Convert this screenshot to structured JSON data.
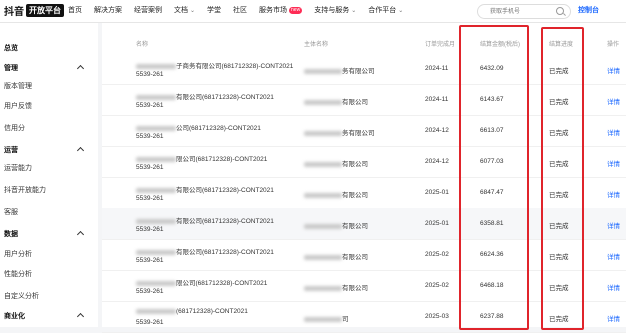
{
  "brand": {
    "name": "抖音",
    "badge": "开放平台"
  },
  "nav": [
    {
      "label": "首页",
      "dropdown": false
    },
    {
      "label": "解决方案",
      "dropdown": false
    },
    {
      "label": "经营案例",
      "dropdown": false
    },
    {
      "label": "文档",
      "dropdown": true
    },
    {
      "label": "学堂",
      "dropdown": false
    },
    {
      "label": "社区",
      "dropdown": false
    },
    {
      "label": "服务市场",
      "dropdown": false,
      "tag": "new"
    },
    {
      "label": "支持与服务",
      "dropdown": true
    },
    {
      "label": "合作平台",
      "dropdown": true
    }
  ],
  "search": {
    "placeholder": "获取手机号"
  },
  "console_label": "控制台",
  "sidebar": [
    {
      "label": "总览",
      "type": "home"
    },
    {
      "label": "管理",
      "type": "group"
    },
    {
      "label": "版本管理",
      "type": "item"
    },
    {
      "label": "用户反馈",
      "type": "item"
    },
    {
      "label": "信用分",
      "type": "item"
    },
    {
      "label": "运营",
      "type": "group"
    },
    {
      "label": "运营能力",
      "type": "item"
    },
    {
      "label": "抖音开放能力",
      "type": "item"
    },
    {
      "label": "客服",
      "type": "item"
    },
    {
      "label": "数据",
      "type": "group"
    },
    {
      "label": "用户分析",
      "type": "item"
    },
    {
      "label": "性能分析",
      "type": "item"
    },
    {
      "label": "自定义分析",
      "type": "item"
    },
    {
      "label": "商业化",
      "type": "group"
    }
  ],
  "table": {
    "headers": [
      "名称",
      "主体名称",
      "订单完成月",
      "结算金额(税后)",
      "结算进度",
      "操作"
    ],
    "rows": [
      {
        "name_visible": "子商务有限公司(681712328)-CONT2021",
        "name_line2": "5539-261",
        "subject_visible": "务有限公司",
        "month": "2024-11",
        "amount": "6432.09",
        "status": "已完成",
        "action": "详情"
      },
      {
        "name_visible": "有限公司(681712328)-CONT2021",
        "name_line2": "5539-261",
        "subject_visible": "有限公司",
        "month": "2024-11",
        "amount": "6143.67",
        "status": "已完成",
        "action": "详情"
      },
      {
        "name_visible": "公司(681712328)-CONT2021",
        "name_line2": "5539-261",
        "subject_visible": "务有限公司",
        "month": "2024-12",
        "amount": "6613.07",
        "status": "已完成",
        "action": "详情"
      },
      {
        "name_visible": "限公司(681712328)-CONT2021",
        "name_line2": "5539-261",
        "subject_visible": "有限公司",
        "month": "2024-12",
        "amount": "6077.03",
        "status": "已完成",
        "action": "详情"
      },
      {
        "name_visible": "有限公司(681712328)-CONT2021",
        "name_line2": "5539-261",
        "subject_visible": "有限公司",
        "month": "2025-01",
        "amount": "6847.47",
        "status": "已完成",
        "action": "详情"
      },
      {
        "name_visible": "有限公司(681712328)-CONT2021",
        "name_line2": "5539-261",
        "subject_visible": "有限公司",
        "month": "2025-01",
        "amount": "6358.81",
        "status": "已完成",
        "action": "详情"
      },
      {
        "name_visible": "有限公司(681712328)-CONT2021",
        "name_line2": "5539-261",
        "subject_visible": "有限公司",
        "month": "2025-02",
        "amount": "6624.36",
        "status": "已完成",
        "action": "详情"
      },
      {
        "name_visible": "限公司(681712328)-CONT2021",
        "name_line2": "5539-261",
        "subject_visible": "有限公司",
        "month": "2025-02",
        "amount": "6468.18",
        "status": "已完成",
        "action": "详情"
      },
      {
        "name_visible": "(681712328)-CONT2021",
        "name_line2": "5539-261",
        "subject_visible": "司",
        "month": "2025-03",
        "amount": "6237.88",
        "status": "已完成",
        "action": "详情"
      }
    ]
  },
  "highlight_color": "#e0242b",
  "accent_color": "#1c68ff"
}
